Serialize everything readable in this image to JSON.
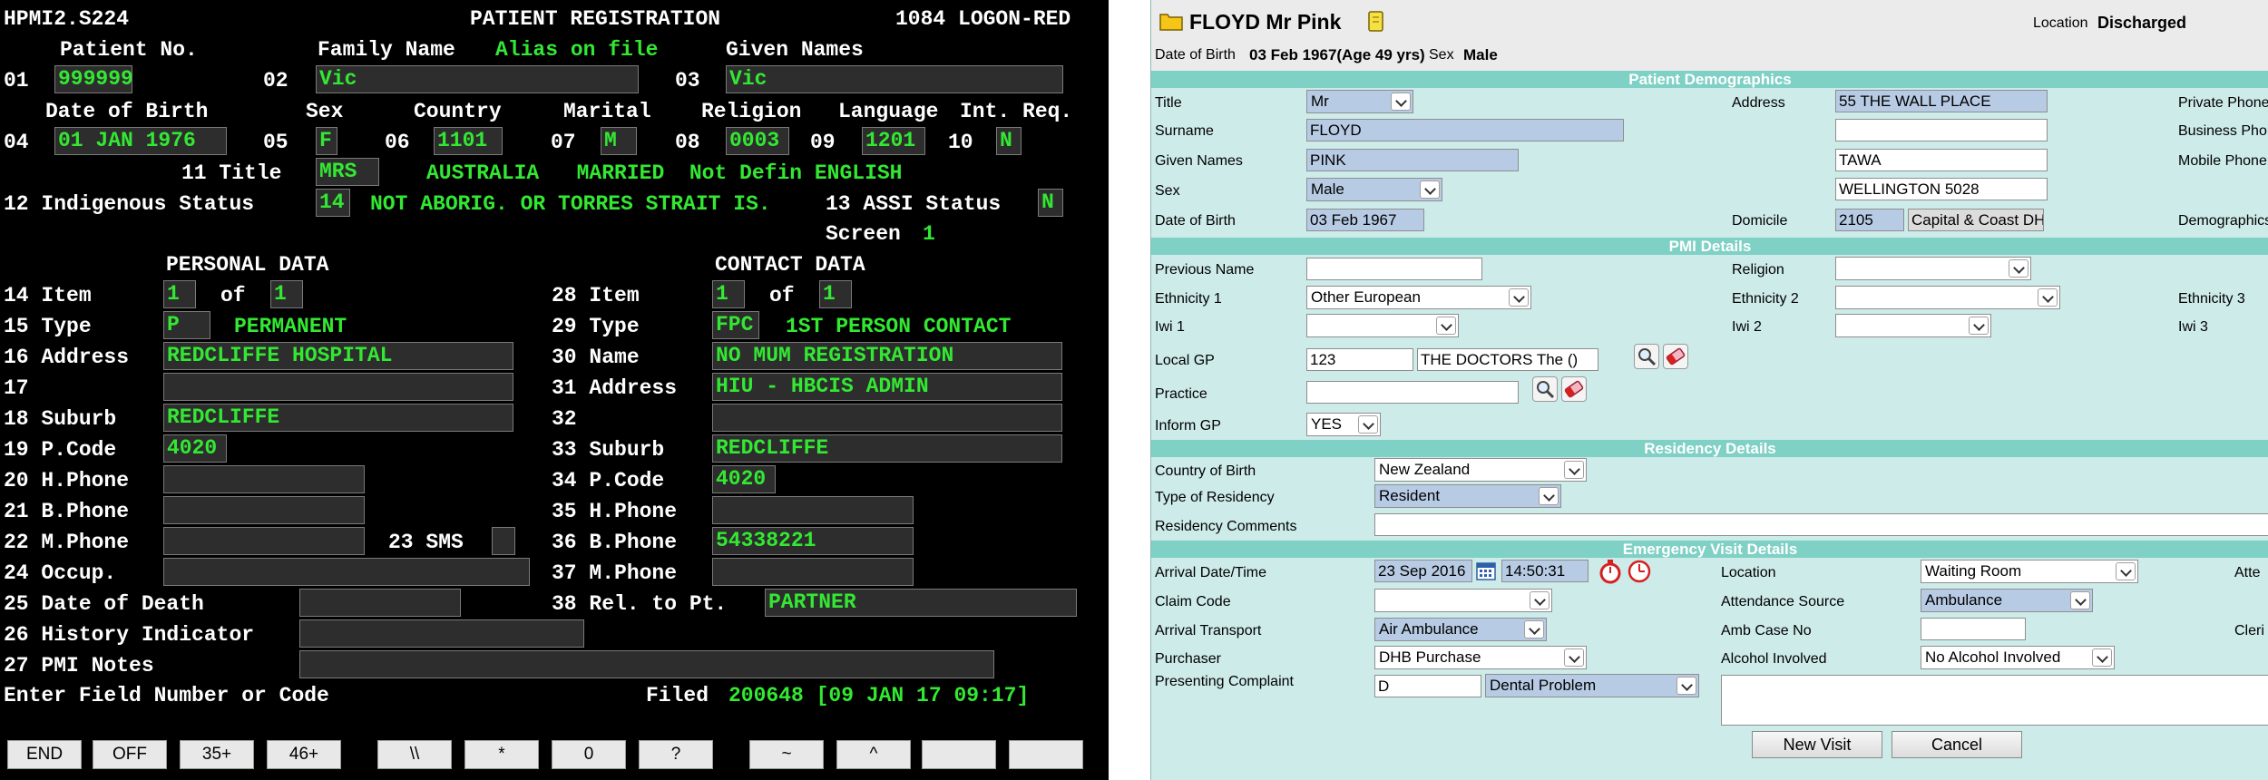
{
  "terminal": {
    "program": "HPMI2.S224",
    "title": "PATIENT REGISTRATION",
    "logon": "1084 LOGON-RED",
    "labels": {
      "patient_no": "Patient No.",
      "family_name": "Family Name",
      "alias": "Alias on file",
      "given_names": "Given Names",
      "dob": "Date of Birth",
      "sex": "Sex",
      "country": "Country",
      "marital": "Marital",
      "religion": "Religion",
      "language": "Language",
      "int_req": "Int. Req.",
      "title": "11 Title",
      "indigenous": "12 Indigenous Status",
      "assi": "13 ASSI Status",
      "screen": "Screen",
      "personal": "PERSONAL DATA",
      "contact": "CONTACT DATA",
      "of": "of"
    },
    "num": {
      "n01": "01",
      "n02": "02",
      "n03": "03",
      "n04": "04",
      "n05": "05",
      "n06": "06",
      "n07": "07",
      "n08": "08",
      "n09": "09",
      "n10": "10"
    },
    "values": {
      "patient_no": "999999",
      "family_name": "Vic",
      "given_names": "Vic",
      "dob": "01 JAN 1976",
      "sex": "F",
      "country": "1101",
      "marital": "M",
      "religion": "0003",
      "language": "1201",
      "int_req": "N",
      "title": "MRS",
      "title_desc": "AUSTRALIA   MARRIED  Not Defin ENGLISH",
      "indigenous": "14",
      "indigenous_desc": "NOT ABORIG. OR TORRES STRAIT IS.",
      "assi": "N",
      "screen": "1"
    },
    "personal": {
      "rows": [
        {
          "label": "14 Item",
          "value": "1",
          "of_value": "1"
        },
        {
          "label": "15 Type",
          "value": "P",
          "desc": "PERMANENT"
        },
        {
          "label": "16 Address",
          "value": "REDCLIFFE HOSPITAL"
        },
        {
          "label": "17",
          "value": ""
        },
        {
          "label": "18 Suburb",
          "value": "REDCLIFFE"
        },
        {
          "label": "19 P.Code",
          "value": "4020"
        },
        {
          "label": "20 H.Phone",
          "value": ""
        },
        {
          "label": "21 B.Phone",
          "value": ""
        },
        {
          "label": "22 M.Phone",
          "value": "",
          "sms_label": "23 SMS",
          "sms_value": ""
        },
        {
          "label": "24 Occup.",
          "value": ""
        },
        {
          "label": "25 Date of Death",
          "value": ""
        },
        {
          "label": "26 History Indicator",
          "value": ""
        },
        {
          "label": "27 PMI Notes",
          "value": ""
        }
      ]
    },
    "contact": {
      "rows": [
        {
          "label": "28 Item",
          "value": "1",
          "of_value": "1"
        },
        {
          "label": "29 Type",
          "value": "FPC",
          "desc": "1ST PERSON CONTACT"
        },
        {
          "label": "30 Name",
          "value": "NO MUM REGISTRATION"
        },
        {
          "label": "31 Address",
          "value": "HIU - HBCIS ADMIN"
        },
        {
          "label": "32",
          "value": ""
        },
        {
          "label": "33 Suburb",
          "value": "REDCLIFFE"
        },
        {
          "label": "34 P.Code",
          "value": "4020"
        },
        {
          "label": "35 H.Phone",
          "value": ""
        },
        {
          "label": "36 B.Phone",
          "value": "54338221"
        },
        {
          "label": "37 M.Phone",
          "value": ""
        },
        {
          "label": "38 Rel. to Pt.",
          "value": "PARTNER"
        }
      ]
    },
    "prompt": "Enter Field Number or Code",
    "filed_label": "Filed",
    "filed_value": "200648 [09 JAN 17 09:17]",
    "fkeys": [
      "END",
      "OFF",
      "35+",
      "46+",
      "\\\\",
      "*",
      "0",
      "?",
      "~",
      "^",
      "",
      ""
    ]
  },
  "app": {
    "header": {
      "folder_icon": "folder-icon",
      "name": "FLOYD Mr Pink",
      "location_label": "Location",
      "location_value": "Discharged",
      "dob_label": "Date of Birth",
      "dob_value": "03 Feb 1967(Age 49 yrs)",
      "sex_label": "Sex",
      "sex_value": "Male"
    },
    "sections": {
      "demographics": "Patient Demographics",
      "pmi": "PMI Details",
      "residency": "Residency Details",
      "emergency": "Emergency Visit Details"
    },
    "demo": {
      "title_label": "Title",
      "title_value": "Mr",
      "surname_label": "Surname",
      "surname_value": "FLOYD",
      "given_label": "Given Names",
      "given_value": "PINK",
      "sex_label": "Sex",
      "sex_value": "Male",
      "dob_label": "Date of Birth",
      "dob_value": "03 Feb 1967",
      "address_label": "Address",
      "address1": "55 THE WALL PLACE",
      "address2": "",
      "address3": "TAWA",
      "address4": "WELLINGTON 5028",
      "domicile_label": "Domicile",
      "domicile_code": "2105",
      "domicile_name": "Capital & Coast DHB",
      "private_phone_label": "Private Phone",
      "business_phone_label": "Business Phone",
      "mobile_phone_label": "Mobile Phone",
      "demographics_label": "Demographics"
    },
    "pmi": {
      "prev_name_label": "Previous Name",
      "prev_name_value": "",
      "religion_label": "Religion",
      "religion_value": "",
      "eth1_label": "Ethnicity 1",
      "eth1_value": "Other European",
      "eth2_label": "Ethnicity 2",
      "eth2_value": "",
      "eth3_label": "Ethnicity 3",
      "iwi1_label": "Iwi 1",
      "iwi1_value": "",
      "iwi2_label": "Iwi 2",
      "iwi2_value": "",
      "iwi3_label": "Iwi 3",
      "gp_label": "Local GP",
      "gp_code": "123",
      "gp_name": "THE DOCTORS The  ()",
      "practice_label": "Practice",
      "practice_value": "",
      "inform_label": "Inform GP",
      "inform_value": "YES"
    },
    "residency": {
      "cob_label": "Country of Birth",
      "cob_value": "New Zealand",
      "type_label": "Type of Residency",
      "type_value": "Resident",
      "comments_label": "Residency Comments",
      "comments_value": ""
    },
    "emergency": {
      "arrival_label": "Arrival Date/Time",
      "arrival_date": "23 Sep 2016",
      "arrival_time": "14:50:31",
      "location_label": "Location",
      "location_value": "Waiting Room",
      "atte_label": "Atte",
      "claim_label": "Claim Code",
      "claim_value": "",
      "source_label": "Attendance Source",
      "source_value": "Ambulance",
      "transport_label": "Arrival Transport",
      "transport_value": "Air Ambulance",
      "amb_label": "Amb Case No",
      "amb_value": "",
      "cleri_label": "Cleri",
      "purchaser_label": "Purchaser",
      "purchaser_value": "DHB Purchase",
      "alcohol_label": "Alcohol Involved",
      "alcohol_value": "No Alcohol Involved",
      "complaint_label": "Presenting Complaint",
      "complaint_code": "D",
      "complaint_value": "Dental Problem"
    },
    "buttons": {
      "new_visit": "New Visit",
      "cancel": "Cancel"
    },
    "colors": {
      "terminal_bg": "#000000",
      "terminal_text": "#ffffff",
      "terminal_field": "#33e833",
      "app_bg": "#cdebe9",
      "section_bar": "#7fd0c5",
      "field_highlight": "#b8cbe4",
      "folder": "#f5c518",
      "icon_red": "#d62020"
    }
  }
}
